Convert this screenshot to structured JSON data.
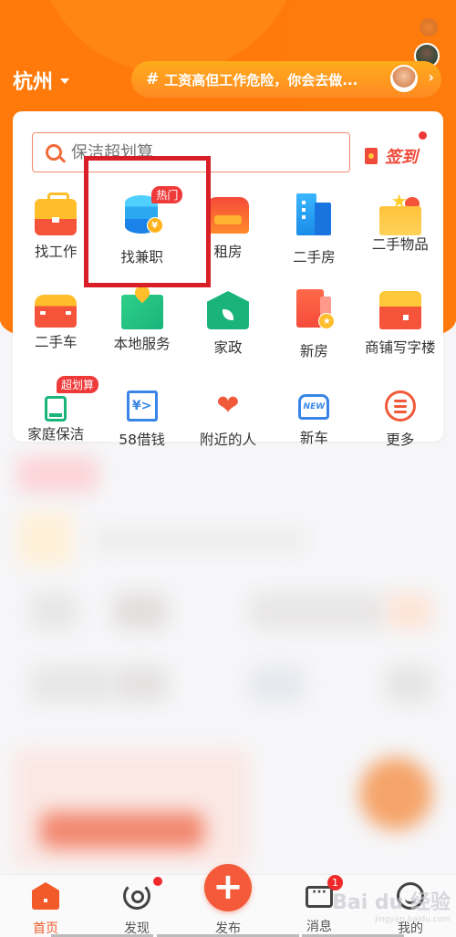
{
  "header": {
    "city": "杭州",
    "topic_text": "工资高但工作危险，你会去做...",
    "topic_hash": "#"
  },
  "search": {
    "placeholder": "保洁超划算",
    "signin_label": "签到"
  },
  "categories": [
    [
      {
        "label": "找工作",
        "icon": "briefcase-icon"
      },
      {
        "label": "找兼职",
        "icon": "coin-stack-icon",
        "tag": "热门",
        "highlighted": true
      },
      {
        "label": "租房",
        "icon": "sofa-icon"
      },
      {
        "label": "二手房",
        "icon": "building-icon"
      },
      {
        "label": "二手物品",
        "icon": "gift-box-icon"
      }
    ],
    [
      {
        "label": "二手车",
        "icon": "car-icon"
      },
      {
        "label": "本地服务",
        "icon": "map-pin-icon"
      },
      {
        "label": "家政",
        "icon": "house-plant-icon"
      },
      {
        "label": "新房",
        "icon": "new-house-icon"
      },
      {
        "label": "商铺写字楼",
        "icon": "shop-icon"
      }
    ],
    [
      {
        "label": "家庭保洁",
        "icon": "cleaning-icon",
        "tag": "超划算"
      },
      {
        "label": "58借钱",
        "icon": "loan-icon"
      },
      {
        "label": "附近的人",
        "icon": "hearts-icon"
      },
      {
        "label": "新车",
        "icon": "new-car-icon"
      },
      {
        "label": "更多",
        "icon": "more-icon"
      }
    ]
  ],
  "icon_glyphs": {
    "yen": "¥",
    "loan": "¥>",
    "heart": "❤",
    "new": "NEW",
    "star": "★",
    "plus": "+",
    "chevron": "›"
  },
  "tabbar": {
    "items": [
      {
        "label": "首页",
        "active": true
      },
      {
        "label": "发现",
        "dot": true
      },
      {
        "label": "发布"
      },
      {
        "label": "消息",
        "badge": "1"
      },
      {
        "label": "我的"
      }
    ]
  },
  "watermark": {
    "text": "Bai du 经验",
    "sub": "jingyan.baidu.com"
  },
  "colors": {
    "brand_orange": "#ff7a0a",
    "accent_red": "#f05a2a",
    "highlight_box": "#d81e26"
  }
}
